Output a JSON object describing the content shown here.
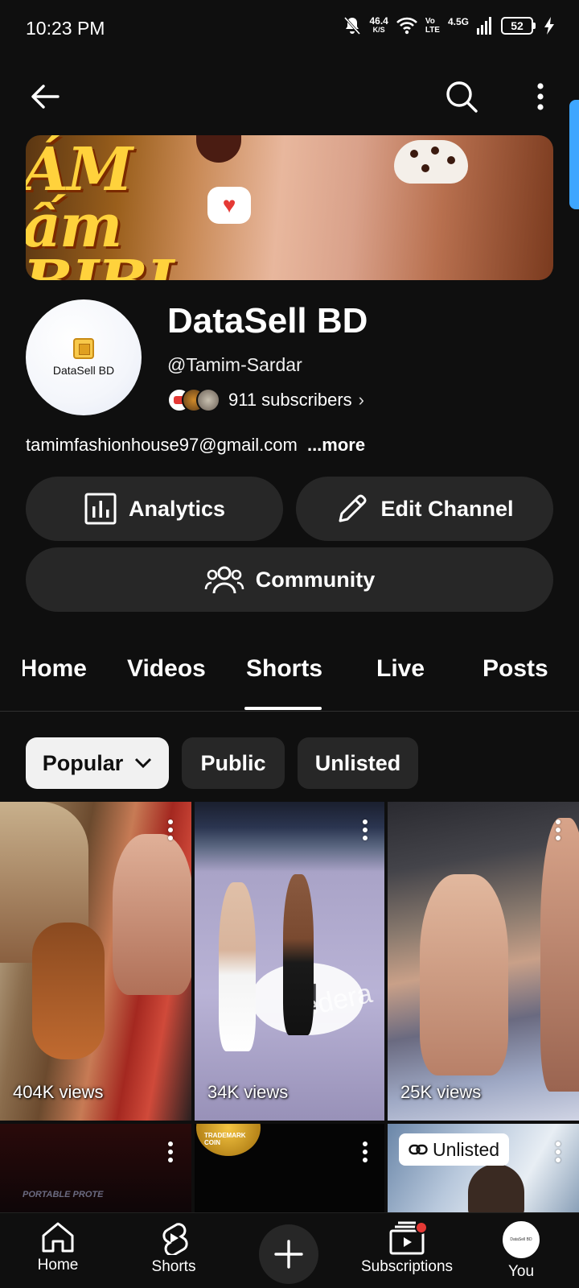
{
  "status_bar": {
    "time": "10:23 PM",
    "net_speed_value": "46.4",
    "net_speed_unit": "K/S",
    "vo_label": "Vo",
    "lte_label": "LTE",
    "signal_label": "4.5G",
    "battery": "52"
  },
  "banner": {
    "text_line1": "ÁM",
    "text_line2": "ấm",
    "text_line3": "BIBI",
    "heart": "♥"
  },
  "channel": {
    "avatar_text": "DataSell BD",
    "name": "DataSell BD",
    "handle": "@Tamim-Sardar",
    "subscribers": "911 subscribers",
    "description": "tamimfashionhouse97@gmail.com",
    "more_label": "...more"
  },
  "actions": {
    "analytics": "Analytics",
    "edit_channel": "Edit Channel",
    "community": "Community"
  },
  "tabs": [
    {
      "label": "Home"
    },
    {
      "label": "Videos"
    },
    {
      "label": "Shorts"
    },
    {
      "label": "Live"
    },
    {
      "label": "Posts"
    }
  ],
  "active_tab": "Shorts",
  "filters": {
    "popular": "Popular",
    "public": "Public",
    "unlisted": "Unlisted"
  },
  "shorts": [
    {
      "views": "404K views"
    },
    {
      "views": "34K views"
    },
    {
      "views": "25K views"
    },
    {
      "views": ""
    },
    {
      "views": ""
    },
    {
      "views": "",
      "badge": "Unlisted"
    }
  ],
  "tile_texts": {
    "ring_brand": "Hedera",
    "portable": "PORTABLE PROTE",
    "coin": "TRADEMARK COIN"
  },
  "bottom_nav": {
    "home": "Home",
    "shorts": "Shorts",
    "subscriptions": "Subscriptions",
    "you": "You",
    "you_avatar_text": "DataSell BD"
  },
  "colors": {
    "background": "#0f0f0f",
    "surface": "#272727",
    "accent_blue": "#3ea6ff",
    "notification_red": "#e53935"
  },
  "icons": [
    "back-arrow-icon",
    "search-icon",
    "more-vert-icon",
    "analytics-icon",
    "pencil-icon",
    "community-icon",
    "chevron-down-icon",
    "link-icon",
    "home-icon",
    "shorts-icon",
    "plus-icon",
    "subscriptions-icon"
  ]
}
